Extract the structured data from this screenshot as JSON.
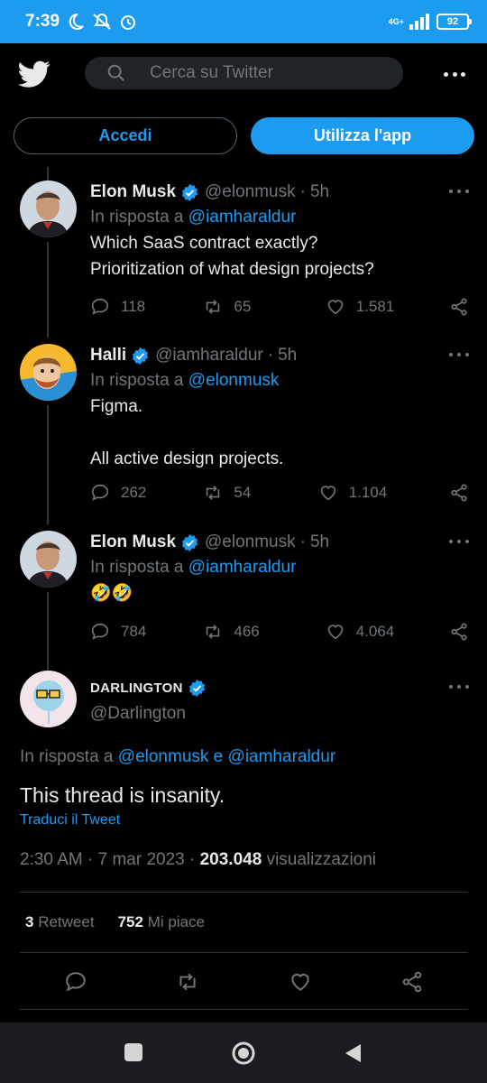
{
  "status_bar": {
    "time": "7:39",
    "network": "4G+",
    "battery": "92"
  },
  "header": {
    "search_placeholder": "Cerca su Twitter"
  },
  "buttons": {
    "login": "Accedi",
    "use_app": "Utilizza l'app"
  },
  "colors": {
    "accent": "#1d9bf0",
    "background": "#000000",
    "muted": "#71767b"
  },
  "tweets": [
    {
      "name": "Elon Musk",
      "handle": "@elonmusk",
      "time": "5h",
      "reply_prefix": "In risposta a",
      "reply_to": "@iamharaldur",
      "text": "Which SaaS contract exactly?\nPrioritization of what design projects?",
      "replies": "118",
      "retweets": "65",
      "likes": "1.581"
    },
    {
      "name": "Halli",
      "handle": "@iamharaldur",
      "time": "5h",
      "reply_prefix": "In risposta a",
      "reply_to": "@elonmusk",
      "text": "Figma.\n\nAll active design projects.",
      "replies": "262",
      "retweets": "54",
      "likes": "1.104"
    },
    {
      "name": "Elon Musk",
      "handle": "@elonmusk",
      "time": "5h",
      "reply_prefix": "In risposta a",
      "reply_to": "@iamharaldur",
      "text": "🤣🤣",
      "replies": "784",
      "retweets": "466",
      "likes": "4.064"
    }
  ],
  "main_tweet": {
    "name": "DARLINGTON",
    "handle": "@Darlington",
    "reply_prefix": "In risposta a",
    "reply_to_1": "@elonmusk",
    "reply_joiner": "e",
    "reply_to_2": "@iamharaldur",
    "text": "This thread is insanity.",
    "translate": "Traduci il Tweet",
    "timestamp": "2:30 AM · 7 mar 2023 ·",
    "views": "203.048",
    "views_label": "visualizzazioni",
    "retweets": "3",
    "retweets_label": "Retweet",
    "likes": "752",
    "likes_label": "Mi piace"
  },
  "icons": [
    "twitter-bird-icon",
    "search-icon",
    "more-icon",
    "verified-badge-icon",
    "reply-icon",
    "retweet-icon",
    "like-icon",
    "share-icon",
    "nav-recents-icon",
    "nav-home-icon",
    "nav-back-icon"
  ]
}
